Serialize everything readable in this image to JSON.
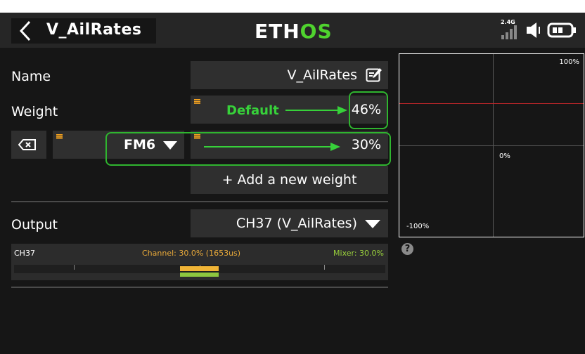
{
  "header": {
    "title": "V_AilRates",
    "logo_e": "ETH",
    "logo_os": "OS",
    "radio_band": "2.4G"
  },
  "form": {
    "name_label": "Name",
    "name_value": "V_AilRates",
    "weight_label": "Weight",
    "weight_value": "46%",
    "fm_value": "FM6",
    "fm_weight_value": "30%",
    "add_weight_label": "+ Add a new weight",
    "output_label": "Output",
    "output_value": "CH37 (V_AilRates)"
  },
  "annotations": {
    "default_label": "Default"
  },
  "graph": {
    "top_label": "100%",
    "mid_label": "0%",
    "bottom_label": "-100%",
    "curve_value_pct": 46,
    "curve_color": "#c0262a"
  },
  "monitor": {
    "channel": "CH37",
    "channel_text": "Channel: 30.0% (1653us)",
    "mixer_text": "Mixer: 30.0%",
    "channel_pct": 30,
    "mixer_pct": 30
  },
  "help_icon": "?",
  "colors": {
    "accent_green": "#2fb52f",
    "orange": "#f0a020",
    "mixer_green": "#8dc63f"
  }
}
